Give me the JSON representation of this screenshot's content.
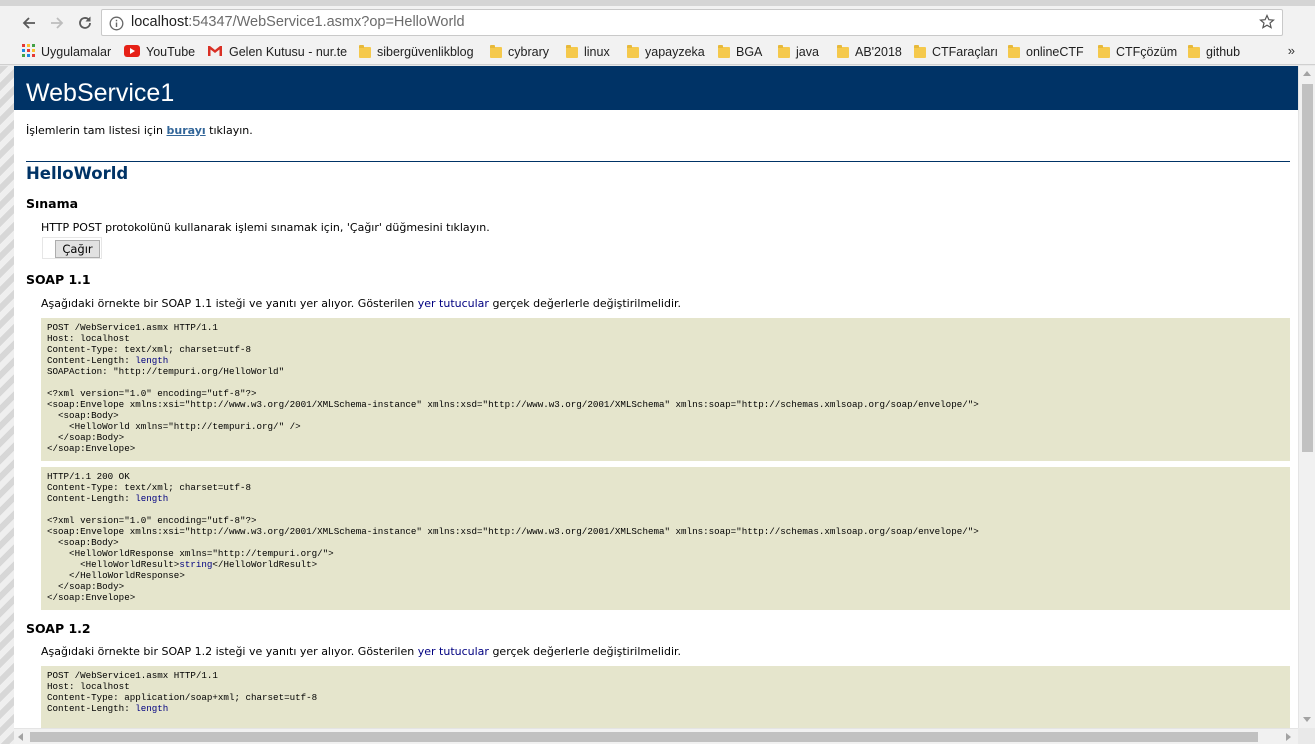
{
  "browser": {
    "url_host": "localhost",
    "url_rest": ":54347/WebService1.asmx?op=HelloWorld",
    "bookmarks": [
      {
        "icon": "apps-grid-icon",
        "label": "Uygulamalar"
      },
      {
        "icon": "youtube-icon",
        "label": "YouTube"
      },
      {
        "icon": "gmail-icon",
        "label": "Gelen Kutusu - nur.te"
      },
      {
        "icon": "folder-icon",
        "label": "sibergüvenlikblog"
      },
      {
        "icon": "folder-icon",
        "label": "cybrary"
      },
      {
        "icon": "folder-icon",
        "label": "linux"
      },
      {
        "icon": "folder-icon",
        "label": "yapayzeka"
      },
      {
        "icon": "folder-icon",
        "label": "BGA"
      },
      {
        "icon": "folder-icon",
        "label": "java"
      },
      {
        "icon": "folder-icon",
        "label": "AB'2018"
      },
      {
        "icon": "folder-icon",
        "label": "CTFaraçları"
      },
      {
        "icon": "folder-icon",
        "label": "onlineCTF"
      },
      {
        "icon": "folder-icon",
        "label": "CTFçözüm"
      },
      {
        "icon": "folder-icon",
        "label": "github"
      }
    ],
    "more_label": "»"
  },
  "page": {
    "service_name": "WebService1",
    "intro_before": "İşlemlerin tam listesi için ",
    "intro_link": "burayı",
    "intro_after": " tıklayın.",
    "operation": "HelloWorld",
    "test_heading": "Sınama",
    "test_text": "HTTP POST protokolünü kullanarak işlemi sınamak için, 'Çağır' düğmesini tıklayın.",
    "invoke_label": "Çağır",
    "soap11_heading": "SOAP 1.1",
    "soap11_text_before": "Aşağıdaki örnekte bir SOAP 1.1 isteği ve yanıtı yer alıyor. Gösterilen ",
    "soap11_text_ph": "yer tutucular",
    "soap11_text_after": " gerçek değerlerle değiştirilmelidir.",
    "soap12_heading": "SOAP 1.2",
    "soap12_text_before": "Aşağıdaki örnekte bir SOAP 1.2 isteği ve yanıtı yer alıyor. Gösterilen ",
    "soap12_text_ph": "yer tutucular",
    "soap12_text_after": " gerçek değerlerle değiştirilmelidir."
  },
  "code_blocks": {
    "soap11_request": [
      [
        "POST /WebService1.asmx HTTP/1.1"
      ],
      [
        "Host: localhost"
      ],
      [
        "Content-Type: text/xml; charset=utf-8"
      ],
      [
        "Content-Length: ",
        "length"
      ],
      [
        "SOAPAction: \"http://tempuri.org/HelloWorld\""
      ],
      [
        ""
      ],
      [
        "<?xml version=\"1.0\" encoding=\"utf-8\"?>"
      ],
      [
        "<soap:Envelope xmlns:xsi=\"http://www.w3.org/2001/XMLSchema-instance\" xmlns:xsd=\"http://www.w3.org/2001/XMLSchema\" xmlns:soap=\"http://schemas.xmlsoap.org/soap/envelope/\">"
      ],
      [
        "  <soap:Body>"
      ],
      [
        "    <HelloWorld xmlns=\"http://tempuri.org/\" />"
      ],
      [
        "  </soap:Body>"
      ],
      [
        "</soap:Envelope>"
      ]
    ],
    "soap11_response": [
      [
        "HTTP/1.1 200 OK"
      ],
      [
        "Content-Type: text/xml; charset=utf-8"
      ],
      [
        "Content-Length: ",
        "length"
      ],
      [
        ""
      ],
      [
        "<?xml version=\"1.0\" encoding=\"utf-8\"?>"
      ],
      [
        "<soap:Envelope xmlns:xsi=\"http://www.w3.org/2001/XMLSchema-instance\" xmlns:xsd=\"http://www.w3.org/2001/XMLSchema\" xmlns:soap=\"http://schemas.xmlsoap.org/soap/envelope/\">"
      ],
      [
        "  <soap:Body>"
      ],
      [
        "    <HelloWorldResponse xmlns=\"http://tempuri.org/\">"
      ],
      [
        "      <HelloWorldResult>",
        "string",
        "</HelloWorldResult>"
      ],
      [
        "    </HelloWorldResponse>"
      ],
      [
        "  </soap:Body>"
      ],
      [
        "</soap:Envelope>"
      ]
    ],
    "soap12_request": [
      [
        "POST /WebService1.asmx HTTP/1.1"
      ],
      [
        "Host: localhost"
      ],
      [
        "Content-Type: application/soap+xml; charset=utf-8"
      ],
      [
        "Content-Length: ",
        "length"
      ]
    ]
  },
  "colors": {
    "header_bg": "#003366",
    "code_bg": "#e5e5cc",
    "placeholder_text": "#000080",
    "link": "#336699"
  }
}
